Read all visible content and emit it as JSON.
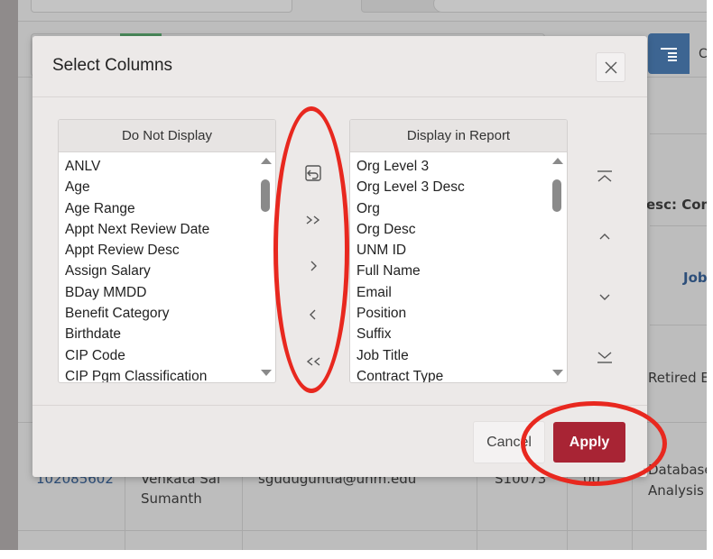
{
  "background": {
    "partial_header": "esc: Com",
    "column_c_glyph": "C",
    "partial_job": "Job",
    "retired_text": "Retired E",
    "row": {
      "id": "102085602",
      "name_line1": "Venkata Sai",
      "name_line2": "Sumanth",
      "email": "sguduguntla@unm.edu",
      "code": "S10073",
      "num": "00",
      "desc_line1": "Database",
      "desc_line2": "Analysis"
    },
    "left_partial_char": "C"
  },
  "modal": {
    "title": "Select Columns",
    "close_icon": "close-x",
    "left_list": {
      "header": "Do Not Display",
      "items": [
        "ANLV",
        "Age",
        "Age Range",
        "Appt Next Review Date",
        "Appt Review Desc",
        "Assign Salary",
        "BDay MMDD",
        "Benefit Category",
        "Birthdate",
        "CIP Code",
        "CIP Pgm Classification"
      ]
    },
    "right_list": {
      "header": "Display in Report",
      "items": [
        "Org Level 3",
        "Org Level 3 Desc",
        "Org",
        "Org Desc",
        "UNM ID",
        "Full Name",
        "Email",
        "Position",
        "Suffix",
        "Job Title",
        "Contract Type"
      ]
    },
    "transfer_buttons": [
      {
        "name": "reset",
        "icon": "reset-icon"
      },
      {
        "name": "move-all-right",
        "icon": ">>"
      },
      {
        "name": "move-right",
        "icon": ">"
      },
      {
        "name": "move-left",
        "icon": "<"
      },
      {
        "name": "move-all-left",
        "icon": "<<"
      }
    ],
    "order_buttons": [
      {
        "name": "move-top",
        "icon": "double-chevron-up-bar"
      },
      {
        "name": "move-up",
        "icon": "chevron-up"
      },
      {
        "name": "move-down",
        "icon": "chevron-down"
      },
      {
        "name": "move-bottom",
        "icon": "chevron-down-bar"
      }
    ],
    "cancel_label": "Cancel",
    "apply_label": "Apply"
  },
  "annotations": {
    "color": "#e8281f",
    "circled": [
      "transfer-buttons",
      "apply-button"
    ]
  },
  "colors": {
    "apply": "#a82434",
    "accent_blue": "#3d6592"
  }
}
